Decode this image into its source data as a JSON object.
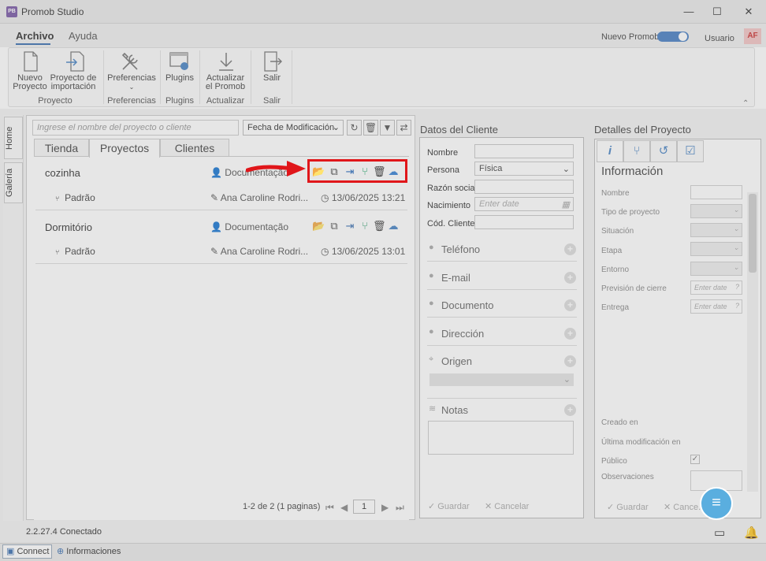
{
  "window": {
    "app_logo": "PB",
    "title": "Promob Studio",
    "minimize": "—",
    "maximize": "☐",
    "close": "✕"
  },
  "menu": {
    "archivo": "Archivo",
    "ayuda": "Ayuda",
    "nuevo_promob": "Nuevo Promob",
    "usuario": "Usuario",
    "avatar_initials": "AF"
  },
  "ribbon": {
    "nuevo_proyecto": [
      "Nuevo",
      "Proyecto"
    ],
    "proyecto_importacion": [
      "Proyecto de",
      "importación"
    ],
    "group_proyecto": "Proyecto",
    "preferencias": "Preferencias",
    "group_preferencias": "Preferencias",
    "plugins": "Plugins",
    "group_plugins": "Plugins",
    "actualizar": [
      "Actualizar",
      "el Promob"
    ],
    "group_actualizar": "Actualizar",
    "salir": "Salir",
    "group_salir": "Salir"
  },
  "side_tabs": {
    "home": "Home",
    "galeria": "Galería"
  },
  "projects": {
    "search_placeholder": "Ingrese el nombre del proyecto o cliente",
    "sort_value": "Fecha de Modificación",
    "tabs": [
      "Tienda",
      "Proyectos",
      "Clientes"
    ],
    "items": [
      {
        "name": "cozinha",
        "doc": "Documentação",
        "sub": "Padrão",
        "author": "Ana Caroline Rodri...",
        "date": "13/06/2025 13:21"
      },
      {
        "name": "Dormitório",
        "doc": "Documentação",
        "sub": "Padrão",
        "author": "Ana Caroline Rodri...",
        "date": "13/06/2025 13:01"
      }
    ],
    "pager_text": "1-2 de 2 (1 paginas)",
    "pager_page": "1"
  },
  "client": {
    "title": "Datos del Cliente",
    "nombre": "Nombre",
    "persona": "Persona",
    "persona_value": "Física",
    "razon_social": "Razón social",
    "nacimiento": "Nacimiento",
    "nacimiento_placeholder": "Enter date",
    "cod_cliente": "Cód. Cliente",
    "telefono": "Teléfono",
    "email": "E-mail",
    "documento": "Documento",
    "direccion": "Dirección",
    "origen": "Origen",
    "notas": "Notas",
    "guardar": "Guardar",
    "cancelar": "Cancelar"
  },
  "details": {
    "title": "Detalles del Proyecto",
    "info_title": "Información",
    "nombre": "Nombre",
    "tipo": "Tipo de proyecto",
    "situacion": "Situación",
    "etapa": "Etapa",
    "entorno": "Entorno",
    "prevision": "Previsión de cierre",
    "entrega": "Entrega",
    "date_placeholder": "Enter date",
    "creado": "Creado en",
    "ultima": "Última modificación en",
    "publico": "Público",
    "observaciones": "Observaciones",
    "guardar": "Guardar",
    "cancelar": "Cance..."
  },
  "status": {
    "version": "2.2.27.4",
    "connected": "Conectado",
    "connect": "Connect",
    "informaciones": "Informaciones"
  }
}
